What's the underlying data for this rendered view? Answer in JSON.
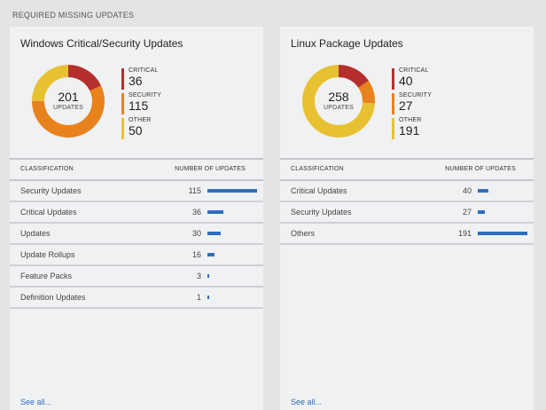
{
  "section_title": "REQUIRED MISSING UPDATES",
  "colors": {
    "critical": "#b5302c",
    "security": "#e8821c",
    "other": "#e8c132",
    "bar": "#2e6dbe"
  },
  "windows": {
    "title": "Windows Critical/Security Updates",
    "total": "201",
    "total_label": "UPDATES",
    "legend": [
      {
        "name": "CRITICAL",
        "value": "36"
      },
      {
        "name": "SECURITY",
        "value": "115"
      },
      {
        "name": "OTHER",
        "value": "50"
      }
    ],
    "col_classification": "CLASSIFICATION",
    "col_count": "NUMBER OF UPDATES",
    "rows": [
      {
        "name": "Security Updates",
        "count": "115",
        "value": 115
      },
      {
        "name": "Critical Updates",
        "count": "36",
        "value": 36
      },
      {
        "name": "Updates",
        "count": "30",
        "value": 30
      },
      {
        "name": "Update Rollups",
        "count": "16",
        "value": 16
      },
      {
        "name": "Feature Packs",
        "count": "3",
        "value": 3
      },
      {
        "name": "Definition Updates",
        "count": "1",
        "value": 1
      }
    ],
    "see_all": "See all..."
  },
  "linux": {
    "title": "Linux Package Updates",
    "total": "258",
    "total_label": "UPDATES",
    "legend": [
      {
        "name": "CRITICAL",
        "value": "40"
      },
      {
        "name": "SECURITY",
        "value": "27"
      },
      {
        "name": "OTHER",
        "value": "191"
      }
    ],
    "col_classification": "CLASSIFICATION",
    "col_count": "NUMBER OF UPDATES",
    "rows": [
      {
        "name": "Critical Updates",
        "count": "40",
        "value": 40
      },
      {
        "name": "Security Updates",
        "count": "27",
        "value": 27
      },
      {
        "name": "Others",
        "count": "191",
        "value": 191
      }
    ],
    "see_all": "See all..."
  }
}
